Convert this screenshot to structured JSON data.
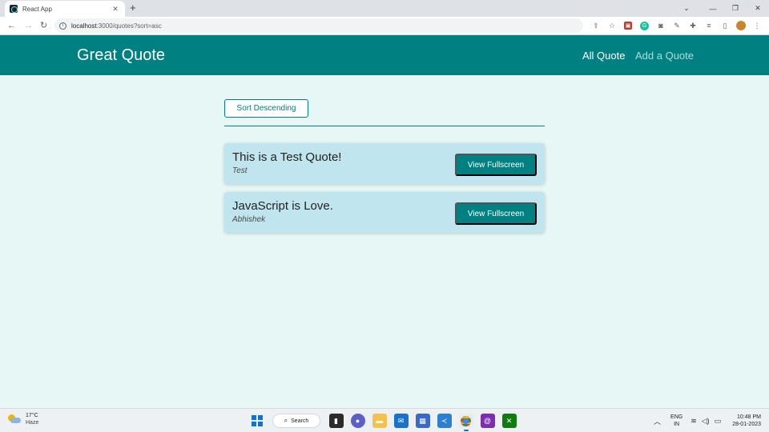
{
  "browser": {
    "tab_title": "React App",
    "tab_close": "✕",
    "new_tab": "+",
    "url_host": "localhost",
    "url_path": ":3000/quotes?sort=asc"
  },
  "header": {
    "logo": "Great Quote",
    "nav": [
      {
        "label": "All Quote",
        "active": true
      },
      {
        "label": "Add a Quote",
        "active": false
      }
    ]
  },
  "main": {
    "sort_button": "Sort Descending",
    "quotes": [
      {
        "text": "This is a Test Quote!",
        "author": "Test",
        "button": "View Fullscreen"
      },
      {
        "text": "JavaScript is Love.",
        "author": "Abhishek",
        "button": "View Fullscreen"
      }
    ]
  },
  "taskbar": {
    "weather_temp": "17°C",
    "weather_cond": "Haze",
    "search_label": "Search",
    "lang_top": "ENG",
    "lang_bottom": "IN",
    "time": "10:48 PM",
    "date": "28-01-2023"
  },
  "colors": {
    "brand": "#008080",
    "card": "#c1e5ee",
    "background": "#e6f7f6"
  }
}
